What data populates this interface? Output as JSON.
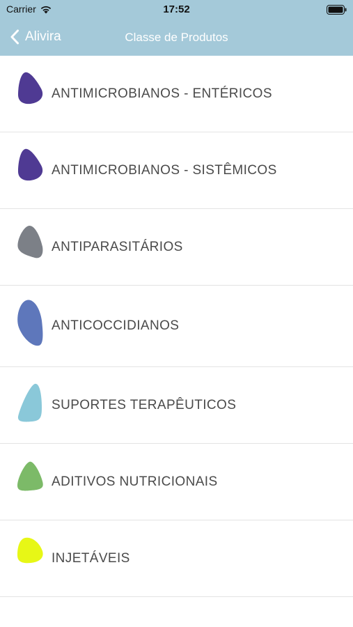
{
  "status_bar": {
    "carrier": "Carrier",
    "time": "17:52",
    "wifi_icon": "wifi-icon",
    "battery_icon": "battery-icon"
  },
  "nav": {
    "back_label": "Alivira",
    "title": "Classe de Produtos",
    "background_color": "#a4c9d9"
  },
  "categories": [
    {
      "label": "ANTIMICROBIANOS - ENTÉRICOS",
      "icon": "purple-blob-icon",
      "color": "#4f3a93"
    },
    {
      "label": "ANTIMICROBIANOS - SISTÊMICOS",
      "icon": "purple-blob-icon",
      "color": "#4f3a93"
    },
    {
      "label": "ANTIPARASITÁRIOS",
      "icon": "gray-blob-icon",
      "color": "#7c8087"
    },
    {
      "label": "ANTICOCCIDIANOS",
      "icon": "blue-blob-icon",
      "color": "#5e77bb"
    },
    {
      "label": "SUPORTES TERAPÊUTICOS",
      "icon": "light-blue-blob-icon",
      "color": "#8ac8d9"
    },
    {
      "label": "ADITIVOS NUTRICIONAIS",
      "icon": "green-blob-icon",
      "color": "#7cba68"
    },
    {
      "label": "INJETÁVEIS",
      "icon": "yellow-blob-icon",
      "color": "#e7f716"
    }
  ]
}
